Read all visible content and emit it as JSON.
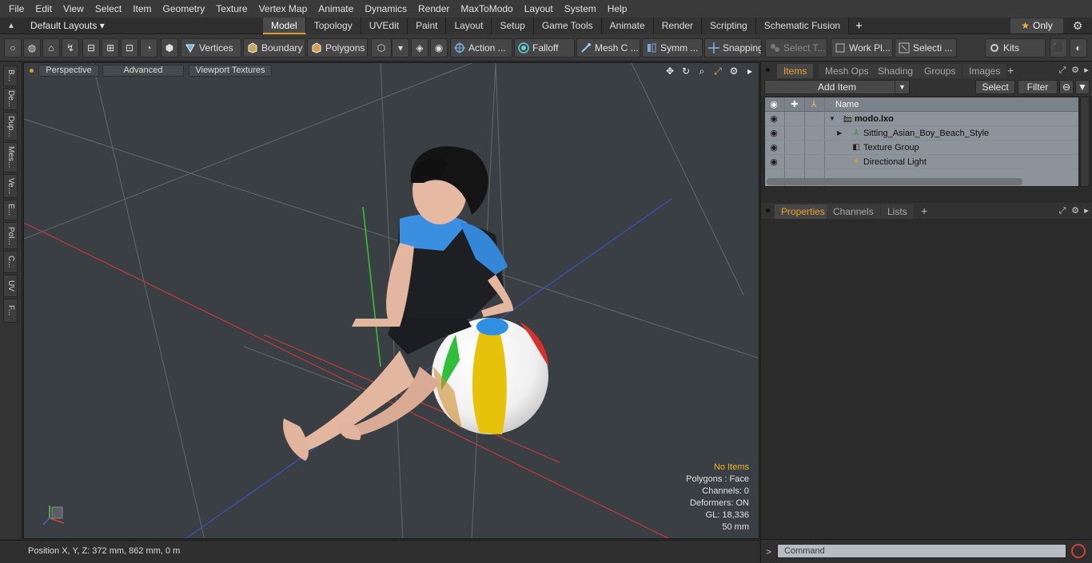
{
  "menu": [
    "File",
    "Edit",
    "View",
    "Select",
    "Item",
    "Geometry",
    "Texture",
    "Vertex Map",
    "Animate",
    "Dynamics",
    "Render",
    "MaxToModo",
    "Layout",
    "System",
    "Help"
  ],
  "layout_bar": {
    "layouts_dropdown": "Default Layouts",
    "tabs": [
      "Model",
      "Topology",
      "UVEdit",
      "Paint",
      "Layout",
      "Setup",
      "Game Tools",
      "Animate",
      "Render",
      "Scripting",
      "Schematic Fusion"
    ],
    "active_tab": "Model",
    "add_tab": "+",
    "only_label": "Only"
  },
  "toolbar": {
    "vertices": "Vertices",
    "boundary": "Boundary",
    "polygons": "Polygons",
    "action": "Action ...",
    "falloff": "Falloff",
    "mesh_c": "Mesh C ...",
    "symm": "Symm ...",
    "snapping": "Snapping",
    "select_t": "Select T...",
    "work_pl": "Work Pl...",
    "selecti": "Selecti ...",
    "kits": "Kits"
  },
  "left_tabs": [
    "B...",
    "De...",
    "Dup...",
    "Mes...",
    "Ve...",
    "E...",
    "Pol...",
    "C...",
    "UV",
    "F..."
  ],
  "viewport": {
    "perspective": "Perspective",
    "advanced": "Advanced",
    "viewport_textures": "Viewport Textures",
    "info": {
      "no_items": "No Items",
      "polygons": "Polygons : Face",
      "channels": "Channels: 0",
      "deformers": "Deformers: ON",
      "gl": "GL: 18,336",
      "size": "50 mm"
    }
  },
  "status": {
    "position": "Position X, Y, Z:   372 mm, 862 mm, 0 m"
  },
  "items_panel": {
    "tabs": [
      "Items",
      "Mesh Ops",
      "Shading",
      "Groups",
      "Images"
    ],
    "active_tab": "Items",
    "add_item": "Add Item",
    "select": "Select",
    "filter": "Filter",
    "name_header": "Name",
    "tree": [
      {
        "label": "modo.lxo",
        "level": 0,
        "bold": true
      },
      {
        "label": "Sitting_Asian_Boy_Beach_Style",
        "level": 1,
        "bold": false
      },
      {
        "label": "Texture Group",
        "level": 1,
        "bold": false
      },
      {
        "label": "Directional Light",
        "level": 1,
        "bold": false
      }
    ]
  },
  "properties_panel": {
    "tabs": [
      "Properties",
      "Channels",
      "Lists"
    ],
    "active_tab": "Properties"
  },
  "command": {
    "prompt": ">",
    "placeholder": "Command"
  }
}
